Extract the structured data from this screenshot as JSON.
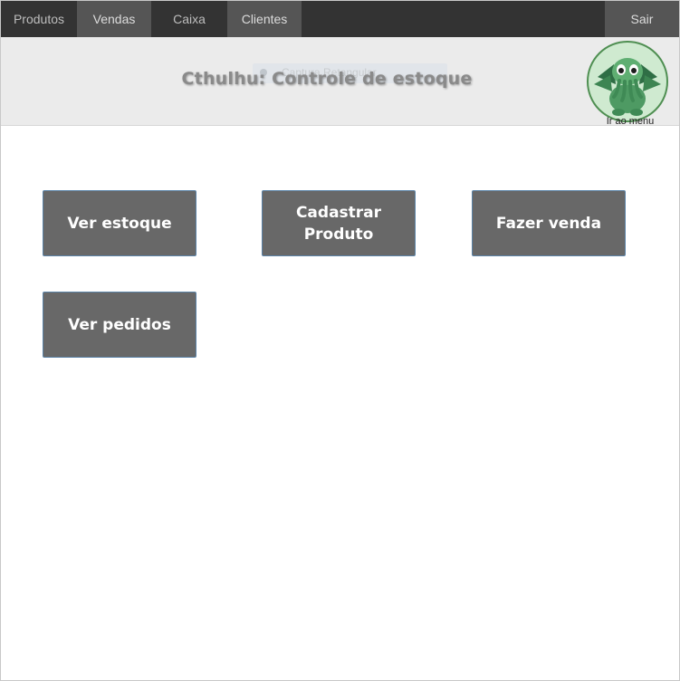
{
  "nav": {
    "tabs": [
      {
        "label": "Produtos"
      },
      {
        "label": "Vendas"
      },
      {
        "label": "Caixa"
      },
      {
        "label": "Clientes"
      }
    ],
    "logout_label": "Sair"
  },
  "header": {
    "title": "Cthulhu: Controle de estoque",
    "overlay_text": "Captura Retangular",
    "logo_link_label": "Ir ao menu",
    "logo_icon": "cthulhu-mascot-icon"
  },
  "actions": [
    {
      "label": "Ver estoque"
    },
    {
      "label": "Cadastrar Produto"
    },
    {
      "label": "Fazer venda"
    },
    {
      "label": "Ver pedidos"
    }
  ],
  "colors": {
    "nav_bg": "#333333",
    "nav_active": "#555555",
    "header_bg": "#ebebeb",
    "button_bg": "#686868",
    "logo_green": "#4f8f52"
  }
}
